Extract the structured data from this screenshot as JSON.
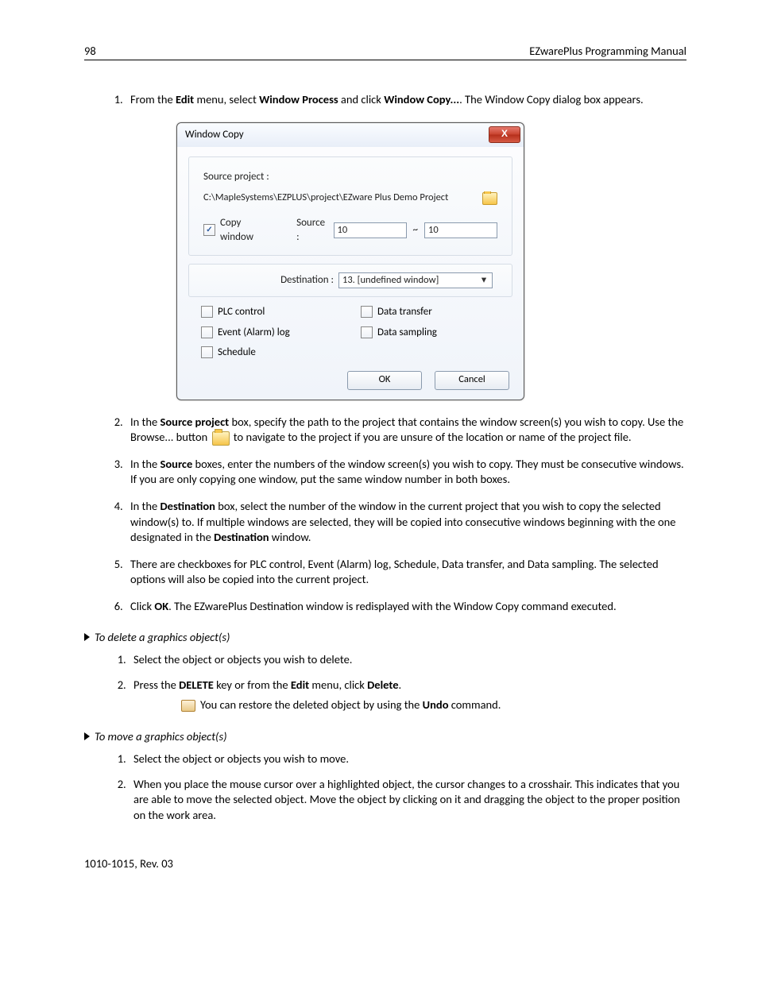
{
  "header": {
    "page_number": "98",
    "manual_title": "EZwarePlus Programming Manual"
  },
  "step1": {
    "prefix": "From the ",
    "bold1": "Edit",
    "mid1": " menu, select ",
    "bold2": "Window Process",
    "mid2": " and click ",
    "bold3": "Window Copy...",
    "suffix": ". The Window Copy dialog box appears."
  },
  "dialog": {
    "title": "Window Copy",
    "close_glyph": "X",
    "source_project_label": "Source project :",
    "source_project_path": "C:\\MapleSystems\\EZPLUS\\project\\EZware Plus Demo Project",
    "copy_window_label": "Copy window",
    "source_label": "Source :",
    "source_from": "10",
    "tilde": "~",
    "source_to": "10",
    "destination_label": "Destination :",
    "destination_value": "13. [undefined window]",
    "dd_glyph": "▾",
    "plc_control": "PLC control",
    "data_transfer": "Data transfer",
    "event_alarm_log": "Event (Alarm) log",
    "data_sampling": "Data sampling",
    "schedule": "Schedule",
    "ok": "OK",
    "cancel": "Cancel"
  },
  "step2": {
    "prefix": "In the ",
    "bold1": "Source project",
    "mid1": " box, specify the path to the project that contains the window screen(s) you wish to copy. Use the Browse... button ",
    "suffix": " to navigate to the project if you are unsure of the location or name of the project file."
  },
  "step3": {
    "prefix": "In the ",
    "bold1": "Source",
    "suffix": " boxes, enter the numbers of the window screen(s) you wish to copy. They must be consecutive windows. If you are only copying one window, put the same window number in both boxes."
  },
  "step4": {
    "prefix": "In the ",
    "bold1": "Destination",
    "mid1": " box, select the number of the window in the current project that you wish to copy the selected window(s) to. If multiple windows are selected, they will be copied into consecutive windows beginning with the one designated in the ",
    "bold2": "Destination",
    "suffix": " window."
  },
  "step5": "There are checkboxes for PLC control, Event (Alarm) log, Schedule, Data transfer, and Data sampling. The selected options will also be copied into the current project.",
  "step6": {
    "prefix": "Click ",
    "bold1": "OK",
    "suffix": ". The EZwarePlus Destination window is redisplayed with the Window Copy command executed."
  },
  "section_delete": {
    "heading": "To delete a graphics object(s)",
    "s1": "Select the object or objects you wish to delete.",
    "s2_prefix": "Press the ",
    "s2_b1": "DELETE",
    "s2_mid": " key or from the ",
    "s2_b2": "Edit",
    "s2_mid2": " menu, click ",
    "s2_b3": "Delete",
    "s2_suffix": ".",
    "note_prefix": "You can restore the deleted object by using the ",
    "note_bold": "Undo",
    "note_suffix": " command."
  },
  "section_move": {
    "heading": "To move a graphics object(s)",
    "s1": "Select the object or objects you wish to move.",
    "s2": "When you place the mouse cursor over a highlighted object, the cursor changes to a crosshair. This indicates that you are able to move the selected object. Move the object by clicking on it and dragging the object to the proper position on the work area."
  },
  "footer_text": "1010-1015, Rev. 03"
}
